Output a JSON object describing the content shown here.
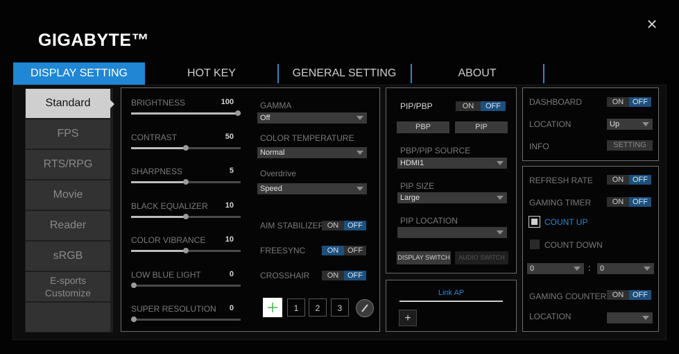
{
  "app": {
    "logo": "GIGABYTE™",
    "close": "✕"
  },
  "tabs": [
    "DISPLAY SETTING",
    "HOT KEY",
    "GENERAL SETTING",
    "ABOUT"
  ],
  "modes": [
    "Standard",
    "FPS",
    "RTS/RPG",
    "Movie",
    "Reader",
    "sRGB",
    "E-sports Customize"
  ],
  "sliders": [
    {
      "label": "BRIGHTNESS",
      "value": "100",
      "fraction": 1.0
    },
    {
      "label": "CONTRAST",
      "value": "50",
      "fraction": 0.5
    },
    {
      "label": "SHARPNESS",
      "value": "5",
      "fraction": 0.5
    },
    {
      "label": "BLACK EQUALIZER",
      "value": "10",
      "fraction": 0.5
    },
    {
      "label": "COLOR VIBRANCE",
      "value": "10",
      "fraction": 0.5
    },
    {
      "label": "LOW BLUE LIGHT",
      "value": "0",
      "fraction": 0.0
    },
    {
      "label": "SUPER RESOLUTION",
      "value": "0",
      "fraction": 0.0
    }
  ],
  "picture": {
    "gamma": {
      "label": "GAMMA",
      "value": "Off"
    },
    "color_temp": {
      "label": "COLOR TEMPERATURE",
      "value": "Normal"
    },
    "overdrive": {
      "label": "Overdrive",
      "value": "Speed"
    },
    "aim": {
      "label": "AIM STABILIZER",
      "on": "ON",
      "off": "OFF",
      "state": "OFF"
    },
    "freesync": {
      "label": "FREESYNC",
      "on": "ON",
      "off": "OFF",
      "state": "ON"
    },
    "crosshair": {
      "label": "CROSSHAIR",
      "on": "ON",
      "off": "OFF",
      "state": "OFF"
    },
    "crosshair_icons": [
      "1",
      "2",
      "3"
    ]
  },
  "pip": {
    "label": "PIP/PBP",
    "on": "ON",
    "off": "OFF",
    "state": "OFF",
    "pbp_button": "PBP",
    "pip_button": "PIP",
    "source_label": "PBP/PIP SOURCE",
    "source_value": "HDMI1",
    "size_label": "PIP SIZE",
    "size_value": "Large",
    "location_label": "PIP LOCATION",
    "location_value": "",
    "display_switch": "DISPLAY SWITCH",
    "audio_switch": "AUDIO SWITCH"
  },
  "link": {
    "label": "Link AP",
    "add": "+"
  },
  "dashboard": {
    "label": "DASHBOARD",
    "on": "ON",
    "off": "OFF",
    "state": "OFF",
    "location_label": "LOCATION",
    "location_value": "Up",
    "info_label": "INFO",
    "setting_button": "SETTING"
  },
  "gaming": {
    "refresh_label": "REFRESH RATE",
    "refresh_state": "OFF",
    "timer_label": "GAMING TIMER",
    "timer_state": "OFF",
    "count_up": "COUNT UP",
    "count_down": "COUNT DOWN",
    "time_a": "0",
    "time_sep": ":",
    "time_b": "0",
    "counter_label": "GAMING COUNTER",
    "counter_state": "OFF",
    "location_label": "LOCATION",
    "location_value": "",
    "on": "ON",
    "off": "OFF"
  },
  "colors": {
    "accent": "#1f87d4",
    "toggle_active": "#1d4f7c",
    "count_up": "#2a86cf"
  }
}
